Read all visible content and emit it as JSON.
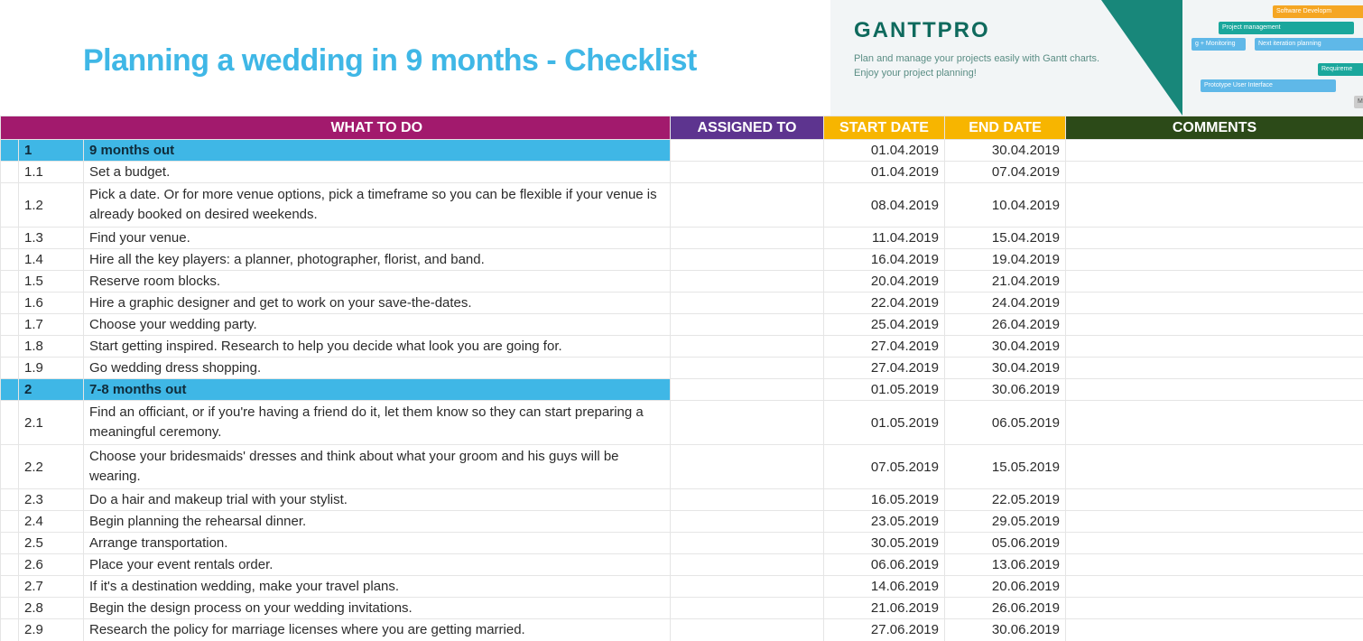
{
  "title": "Planning a wedding in 9 months - Checklist",
  "promo": {
    "logo": "GANTTPRO",
    "line1": "Plan and manage your projects easily with Gantt charts.",
    "line2": "Enjoy your project planning!"
  },
  "headers": {
    "what": "WHAT TO DO",
    "assigned": "ASSIGNED TO",
    "start": "START DATE",
    "end": "END DATE",
    "comments": "COMMENTS"
  },
  "rows": [
    {
      "num": "1",
      "task": "9 months out",
      "start": "01.04.2019",
      "end": "30.04.2019",
      "section": true
    },
    {
      "num": "1.1",
      "task": "Set a budget.",
      "start": "01.04.2019",
      "end": "07.04.2019"
    },
    {
      "num": "1.2",
      "task": "Pick a date. Or for more venue options, pick a timeframe so you can be flexible if your venue is already booked on desired weekends.",
      "start": "08.04.2019",
      "end": "10.04.2019",
      "wrap": true
    },
    {
      "num": "1.3",
      "task": "Find your venue.",
      "start": "11.04.2019",
      "end": "15.04.2019"
    },
    {
      "num": "1.4",
      "task": "Hire all the key players: a planner, photographer, florist, and band.",
      "start": "16.04.2019",
      "end": "19.04.2019"
    },
    {
      "num": "1.5",
      "task": "Reserve room blocks.",
      "start": "20.04.2019",
      "end": "21.04.2019"
    },
    {
      "num": "1.6",
      "task": "Hire a graphic designer and get to work on your save-the-dates.",
      "start": "22.04.2019",
      "end": "24.04.2019"
    },
    {
      "num": "1.7",
      "task": "Choose your wedding party.",
      "start": "25.04.2019",
      "end": "26.04.2019"
    },
    {
      "num": "1.8",
      "task": "Start getting inspired. Research to help you decide what look you are going for.",
      "start": "27.04.2019",
      "end": "30.04.2019"
    },
    {
      "num": "1.9",
      "task": "Go wedding dress shopping.",
      "start": "27.04.2019",
      "end": "30.04.2019"
    },
    {
      "num": "2",
      "task": "7-8 months out",
      "start": "01.05.2019",
      "end": "30.06.2019",
      "section": true
    },
    {
      "num": "2.1",
      "task": "Find an officiant, or if you're having a friend do it, let them know so they can start preparing a meaningful ceremony.",
      "start": "01.05.2019",
      "end": "06.05.2019",
      "wrap": true
    },
    {
      "num": "2.2",
      "task": "Choose your bridesmaids' dresses and think about what your groom and his guys will be wearing.",
      "start": "07.05.2019",
      "end": "15.05.2019",
      "wrap": true
    },
    {
      "num": "2.3",
      "task": "Do a hair and makeup trial with your stylist.",
      "start": "16.05.2019",
      "end": "22.05.2019"
    },
    {
      "num": "2.4",
      "task": "Begin planning the rehearsal dinner.",
      "start": "23.05.2019",
      "end": "29.05.2019"
    },
    {
      "num": "2.5",
      "task": "Arrange transportation.",
      "start": "30.05.2019",
      "end": "05.06.2019"
    },
    {
      "num": "2.6",
      "task": "Place your event rentals order.",
      "start": "06.06.2019",
      "end": "13.06.2019"
    },
    {
      "num": "2.7",
      "task": "If it's a destination wedding, make your travel plans.",
      "start": "14.06.2019",
      "end": "20.06.2019"
    },
    {
      "num": "2.8",
      "task": "Begin the design process on your wedding invitations.",
      "start": "21.06.2019",
      "end": "26.06.2019"
    },
    {
      "num": "2.9",
      "task": "Research the policy for marriage licenses where you are getting married.",
      "start": "27.06.2019",
      "end": "30.06.2019",
      "cut": true
    }
  ],
  "gantt_labels": {
    "b1": "Software Developm",
    "b2": "Project management",
    "b3": "g + Monitoring",
    "b4": "Next iteration planning",
    "b5": "Requireme",
    "b6": "Prototype User Interface",
    "b7": "Ma"
  }
}
